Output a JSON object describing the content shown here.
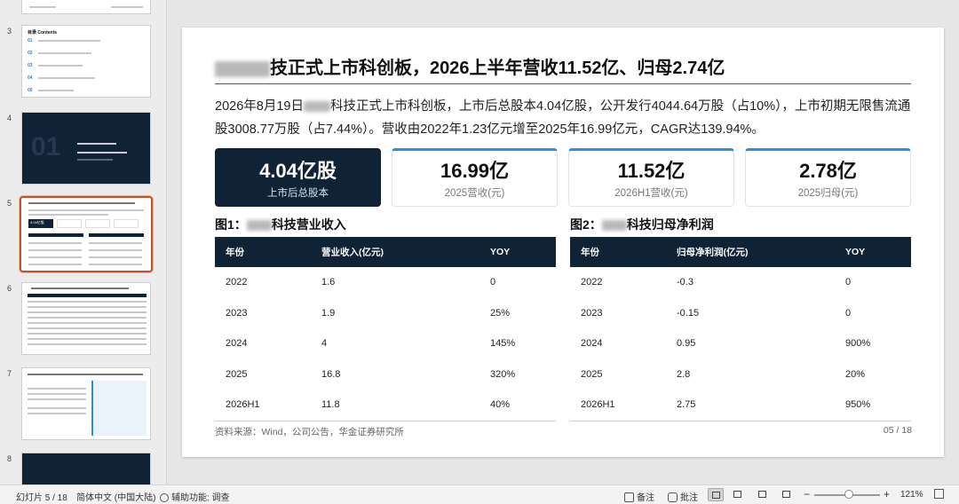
{
  "thumbnails": [
    {
      "num": "3",
      "label": "目录 Contents"
    },
    {
      "num": "4",
      "label": "01"
    },
    {
      "num": "5",
      "label": "4.04亿股"
    },
    {
      "num": "6",
      "label": ""
    },
    {
      "num": "7",
      "label": ""
    },
    {
      "num": "8",
      "label": ""
    }
  ],
  "slide": {
    "title": "技正式上市科创板，2026上半年营收11.52亿、归母2.74亿",
    "summary_pre": "2026年8月19日",
    "summary_post": "科技正式上市科创板，上市后总股本4.04亿股，公开发行4044.64万股（占10%），上市初期无限售流通股3008.77万股（占7.44%）。营收由2022年1.23亿元增至2025年16.99亿元，CAGR达139.94%。",
    "kpis": [
      {
        "value": "4.04亿股",
        "label": "上市后总股本"
      },
      {
        "value": "16.99亿",
        "label": "2025营收(元)"
      },
      {
        "value": "11.52亿",
        "label": "2026H1营收(元)"
      },
      {
        "value": "2.78亿",
        "label": "2025归母(元)"
      }
    ],
    "fig1_prefix": "图1：",
    "fig1_suffix": "科技营业收入",
    "fig2_prefix": "图2：",
    "fig2_suffix": "科技归母净利润",
    "table1": {
      "headers": [
        "年份",
        "营业收入(亿元)",
        "YOY"
      ],
      "rows": [
        [
          "2022",
          "1.6",
          "0"
        ],
        [
          "2023",
          "1.9",
          "25%"
        ],
        [
          "2024",
          "4",
          "145%"
        ],
        [
          "2025",
          "16.8",
          "320%"
        ],
        [
          "2026H1",
          "11.8",
          "40%"
        ]
      ]
    },
    "table2": {
      "headers": [
        "年份",
        "归母净利润(亿元)",
        "YOY"
      ],
      "rows": [
        [
          "2022",
          "-0.3",
          "0"
        ],
        [
          "2023",
          "-0.15",
          "0"
        ],
        [
          "2024",
          "0.95",
          "900%"
        ],
        [
          "2025",
          "2.8",
          "20%"
        ],
        [
          "2026H1",
          "2.75",
          "950%"
        ]
      ]
    },
    "source": "资料来源：Wind，公司公告，华金证券研究所",
    "page": "05 / 18"
  },
  "statusbar": {
    "slide_info": "幻灯片 5 / 18",
    "language": "简体中文 (中国大陆)",
    "accessibility": "辅助功能: 调查",
    "notes": "备注",
    "comments": "批注",
    "zoom_minus": "−",
    "zoom_plus": "+",
    "zoom": "121%"
  },
  "colors": {
    "navy": "#0f2236",
    "accent": "#2b8fdb",
    "selected": "#c0522f"
  }
}
